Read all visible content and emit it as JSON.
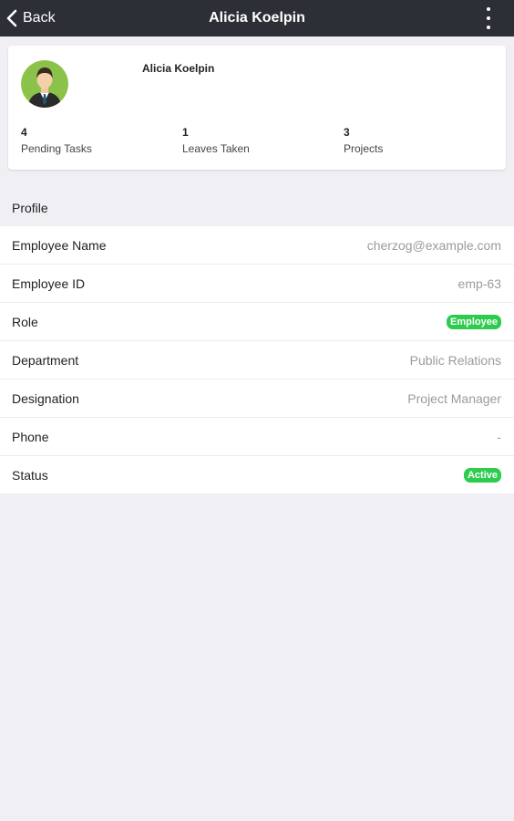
{
  "navbar": {
    "back_label": "Back",
    "title": "Alicia Koelpin"
  },
  "summary": {
    "name": "Alicia Koelpin",
    "stats": [
      {
        "value": "4",
        "label": "Pending Tasks"
      },
      {
        "value": "1",
        "label": "Leaves Taken"
      },
      {
        "value": "3",
        "label": "Projects"
      }
    ]
  },
  "profile": {
    "header": "Profile",
    "rows": [
      {
        "label": "Employee Name",
        "value": "cherzog@example.com"
      },
      {
        "label": "Employee ID",
        "value": "emp-63"
      },
      {
        "label": "Role",
        "value": "Employee"
      },
      {
        "label": "Department",
        "value": "Public Relations"
      },
      {
        "label": "Designation",
        "value": "Project Manager"
      },
      {
        "label": "Phone",
        "value": "-"
      },
      {
        "label": "Status",
        "value": "Active"
      }
    ]
  },
  "colors": {
    "navbar_bg": "#2d2f36",
    "badge_green": "#2ecc4e",
    "avatar_bg": "#8bc34a",
    "page_bg": "#efeff4"
  },
  "icons": {
    "back": "chevron-left-icon",
    "more": "more-vertical-icon"
  }
}
